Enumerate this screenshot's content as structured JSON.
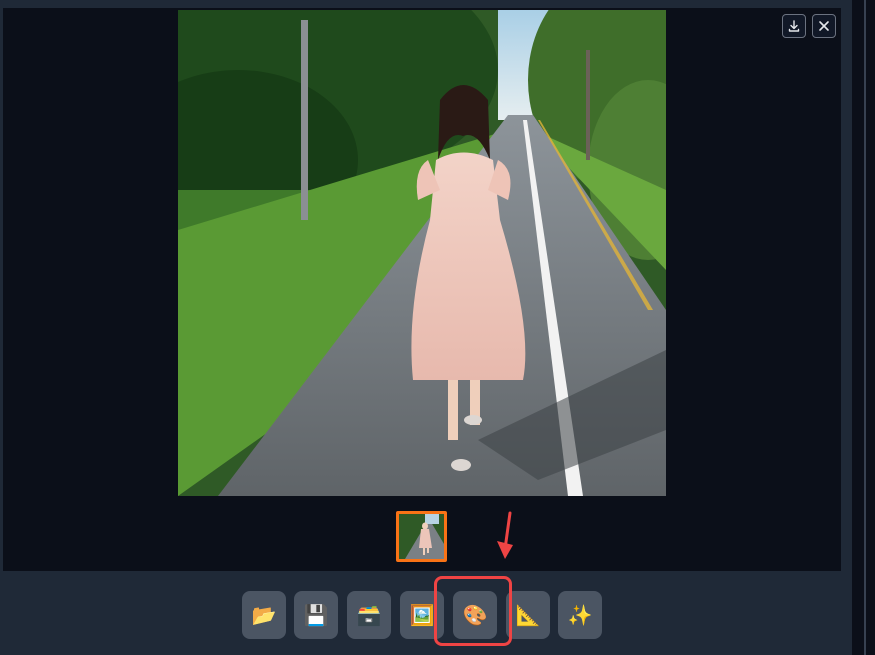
{
  "gallery": {
    "image_alt": "woman in pink dress walking on road",
    "download_icon": "download-icon",
    "close_icon": "close-icon"
  },
  "toolbar": {
    "buttons": [
      {
        "name": "open-folder-button",
        "icon": "folder-icon",
        "glyph": "📂"
      },
      {
        "name": "save-button",
        "icon": "floppy-disk-icon",
        "glyph": "💾"
      },
      {
        "name": "zip-button",
        "icon": "card-box-icon",
        "glyph": "🗃️"
      },
      {
        "name": "send-to-img2img-button",
        "icon": "framed-picture-icon",
        "glyph": "🖼️"
      },
      {
        "name": "send-to-inpaint-button",
        "icon": "palette-icon",
        "glyph": "🎨"
      },
      {
        "name": "send-to-extras-button",
        "icon": "triangular-ruler-icon",
        "glyph": "📐"
      },
      {
        "name": "upscale-button",
        "icon": "sparkles-icon",
        "glyph": "✨"
      }
    ]
  },
  "colors": {
    "accent_orange": "#f97316",
    "highlight_red": "#ef4444",
    "button_bg": "#4b5563",
    "panel_bg": "#1f2937",
    "gallery_bg": "#0b0f19"
  }
}
